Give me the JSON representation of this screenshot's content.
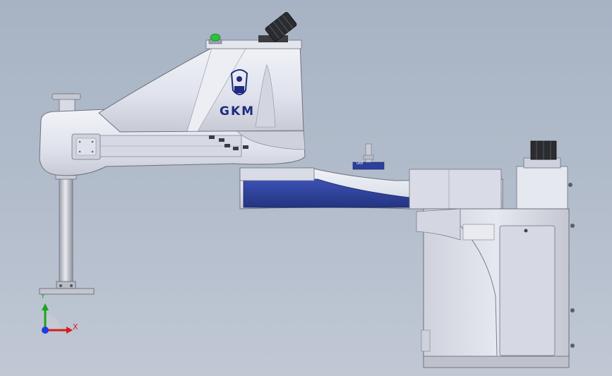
{
  "scene": {
    "brand_text": "GKM",
    "tag_text": "GKM",
    "colors": {
      "background_top": "#a7b3c4",
      "background_bottom": "#c0c8d4",
      "body": "#dfe2ec",
      "body_shadow": "#b9bdc8",
      "accent_blue": "#2d3f9c",
      "status_green": "#29c23a",
      "connector_dark": "#2a2c30"
    }
  },
  "triad": {
    "x_label": "X",
    "y_label": "Y",
    "x_color": "#d81b1b",
    "y_color": "#1ea31e",
    "z_color": "#1f3ce0"
  }
}
